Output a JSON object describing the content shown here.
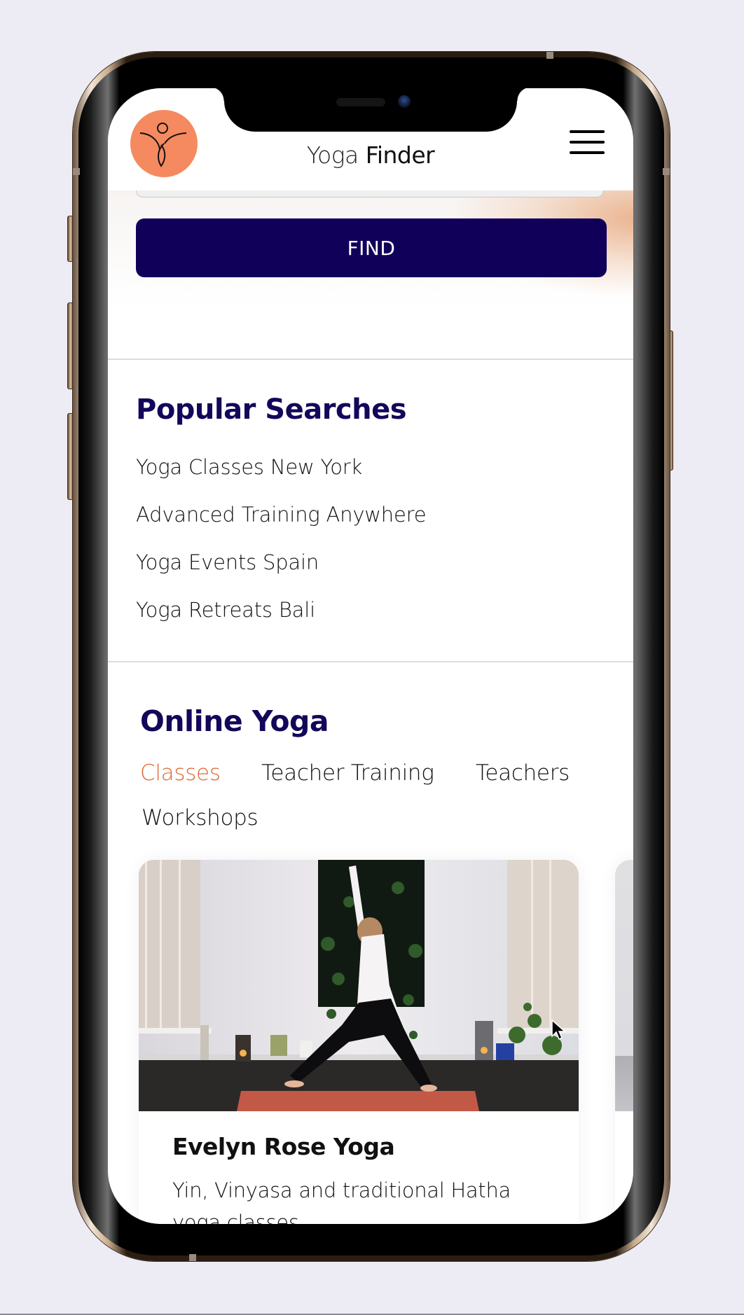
{
  "app": {
    "title_light": "Yoga",
    "title_bold": "Finder",
    "brand_color": "#F58A61",
    "primary_color": "#10005A",
    "accent_color": "#E0672F",
    "logo_icon": "yoga-figure-icon",
    "menu_icon": "hamburger-menu-icon"
  },
  "search": {
    "input_value": "",
    "find_label": "FIND"
  },
  "popular": {
    "title": "Popular Searches",
    "items": [
      "Yoga Classes New York",
      "Advanced Training Anywhere",
      "Yoga Events Spain",
      "Yoga Retreats Bali"
    ]
  },
  "online": {
    "title": "Online Yoga",
    "tabs": [
      {
        "label": "Classes",
        "active": true
      },
      {
        "label": "Teacher Training",
        "active": false
      },
      {
        "label": "Teachers",
        "active": false
      },
      {
        "label": "Workshops",
        "active": false
      }
    ],
    "cards": [
      {
        "title": "Evelyn Rose Yoga",
        "description": "Yin, Vinyasa and traditional Hatha yoga classes",
        "image": "woman-in-warrior-pose-photo"
      }
    ]
  }
}
